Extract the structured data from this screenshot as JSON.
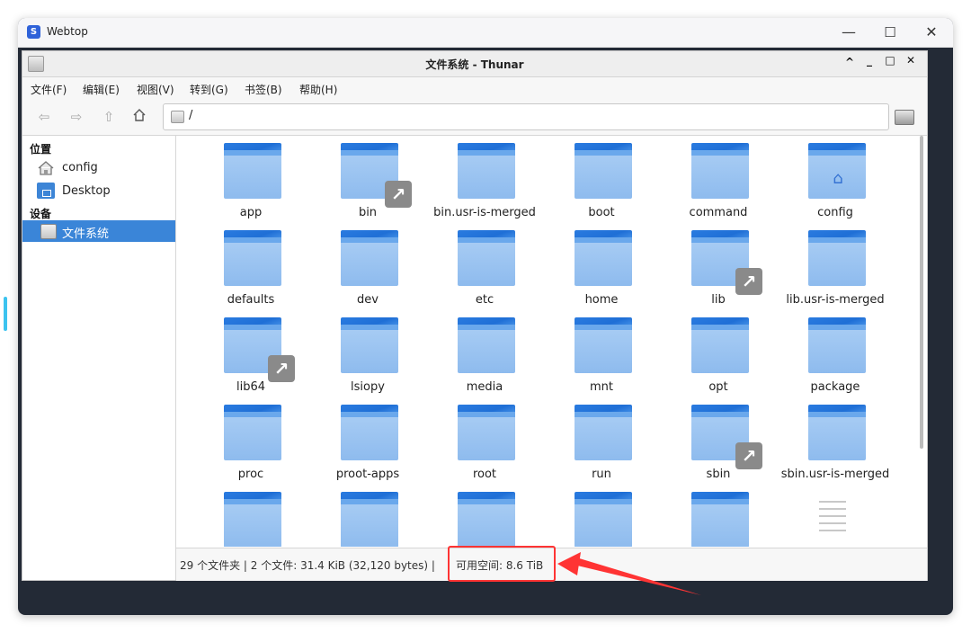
{
  "browser": {
    "title": "Webtop",
    "logo_glyph": "S",
    "controls": {
      "minimize": "—",
      "maximize": "☐",
      "close": "✕"
    }
  },
  "window": {
    "title": "文件系统 - Thunar",
    "controls": {
      "up": "^",
      "minimize": "_",
      "maximize": "□",
      "close": "✕"
    }
  },
  "menu": [
    {
      "label": "文件(F)"
    },
    {
      "label": "编辑(E)"
    },
    {
      "label": "视图(V)"
    },
    {
      "label": "转到(G)"
    },
    {
      "label": "书签(B)"
    },
    {
      "label": "帮助(H)"
    }
  ],
  "toolbar": {
    "back_icon": "arrow-left-icon",
    "forward_icon": "arrow-right-icon",
    "up_icon": "arrow-up-icon",
    "home_icon": "home-icon",
    "location": "/"
  },
  "sidebar": {
    "places_heading": "位置",
    "places": [
      {
        "label": "config",
        "icon": "home-icon"
      },
      {
        "label": "Desktop",
        "icon": "desktop-folder-icon"
      }
    ],
    "devices_heading": "设备",
    "devices": [
      {
        "label": "文件系统",
        "icon": "drive-icon",
        "selected": true
      }
    ]
  },
  "files": [
    {
      "name": "app",
      "type": "folder"
    },
    {
      "name": "bin",
      "type": "folder-link"
    },
    {
      "name": "bin.usr-is-merged",
      "type": "folder"
    },
    {
      "name": "boot",
      "type": "folder"
    },
    {
      "name": "command",
      "type": "folder"
    },
    {
      "name": "config",
      "type": "folder-home"
    },
    {
      "name": "defaults",
      "type": "folder"
    },
    {
      "name": "dev",
      "type": "folder"
    },
    {
      "name": "etc",
      "type": "folder"
    },
    {
      "name": "home",
      "type": "folder"
    },
    {
      "name": "lib",
      "type": "folder-link"
    },
    {
      "name": "lib.usr-is-merged",
      "type": "folder"
    },
    {
      "name": "lib64",
      "type": "folder-link"
    },
    {
      "name": "lsiopy",
      "type": "folder"
    },
    {
      "name": "media",
      "type": "folder"
    },
    {
      "name": "mnt",
      "type": "folder"
    },
    {
      "name": "opt",
      "type": "folder"
    },
    {
      "name": "package",
      "type": "folder"
    },
    {
      "name": "proc",
      "type": "folder"
    },
    {
      "name": "proot-apps",
      "type": "folder"
    },
    {
      "name": "root",
      "type": "folder"
    },
    {
      "name": "run",
      "type": "folder"
    },
    {
      "name": "sbin",
      "type": "folder-link"
    },
    {
      "name": "sbin.usr-is-merged",
      "type": "folder"
    },
    {
      "name": "",
      "type": "folder"
    },
    {
      "name": "",
      "type": "folder"
    },
    {
      "name": "",
      "type": "folder"
    },
    {
      "name": "",
      "type": "folder"
    },
    {
      "name": "",
      "type": "folder"
    },
    {
      "name": "",
      "type": "document"
    }
  ],
  "status": {
    "summary": "29 个文件夹 | 2 个文件: 31.4 KiB (32,120 bytes) |",
    "free_space": "可用空间: 8.6 TiB"
  },
  "colors": {
    "accent": "#3a85d8",
    "folder": "#8ebbee",
    "annotation": "#ff3434"
  }
}
